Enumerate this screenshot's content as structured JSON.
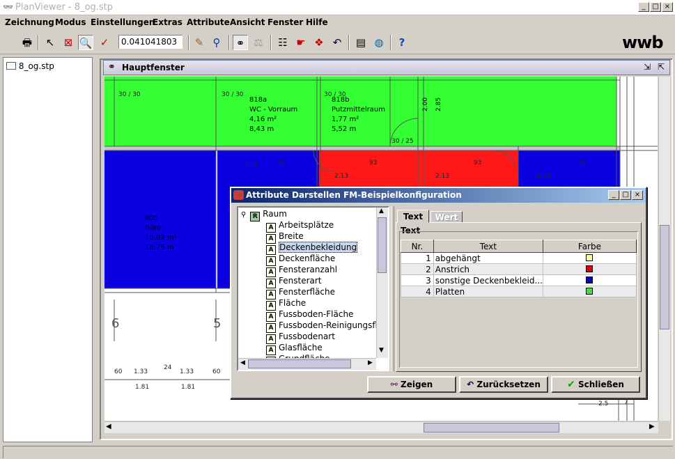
{
  "app": {
    "title": "PlanViewer - 8_og.stp"
  },
  "menu": [
    "Zeichnung",
    "Modus",
    "Einstellungen",
    "Extras",
    "Attribute",
    "Ansicht",
    "Fenster",
    "Hilfe"
  ],
  "toolbar": {
    "zoom_value": "0.041041803",
    "logo": "wwb"
  },
  "left_tree": {
    "file": "8_og.stp"
  },
  "main_window": {
    "title": "Hauptfenster"
  },
  "plan": {
    "rooms": [
      {
        "id": "818a",
        "name": "WC - Vorraum",
        "area": "4,16 m²",
        "perimeter": "8,43 m"
      },
      {
        "id": "818b",
        "name": "Putzmittelraum",
        "area": "1,77 m²",
        "perimeter": "5,52 m"
      },
      {
        "id": "805",
        "name": "Büro",
        "area": "10,92 m²",
        "perimeter": "18,75 m"
      }
    ],
    "dims": [
      "30 / 30",
      "30 / 30",
      "30 / 30",
      "30 / 25",
      "2.00",
      "2.85",
      "2.13",
      "93",
      "93",
      "93",
      "2.13",
      "2.13",
      "2.13",
      "2.13",
      "93",
      "6",
      "5",
      "60",
      "1.33",
      "24",
      "1.33",
      "60",
      "1.81",
      "1.81",
      "2.5",
      "7"
    ]
  },
  "dialog": {
    "title": "Attribute Darstellen FM-Beispielkonfiguration",
    "tree_root": "Raum",
    "tree_items": [
      "Arbeitsplätze",
      "Breite",
      "Deckenbekleidung",
      "Deckenfläche",
      "Fensteranzahl",
      "Fensterart",
      "Fensterfläche",
      "Fläche",
      "Fussboden-Fläche",
      "Fussboden-Reinigungsfl",
      "Fussbodenart",
      "Glasfläche",
      "Grundfläche"
    ],
    "selected_item": "Deckenbekleidung",
    "tabs": [
      "Text",
      "Wert"
    ],
    "group_label": "Text",
    "columns": [
      "Nr.",
      "Text",
      "Farbe"
    ],
    "rows": [
      {
        "nr": "1",
        "text": "abgehängt",
        "color": "#ffff99"
      },
      {
        "nr": "2",
        "text": "Anstrich",
        "color": "#e00000"
      },
      {
        "nr": "3",
        "text": "sonstige Deckenbekleid...",
        "color": "#0000c0"
      },
      {
        "nr": "4",
        "text": "Platten",
        "color": "#44dd44"
      }
    ],
    "buttons": {
      "show": "Zeigen",
      "reset": "Zurücksetzen",
      "close": "Schließen"
    }
  }
}
